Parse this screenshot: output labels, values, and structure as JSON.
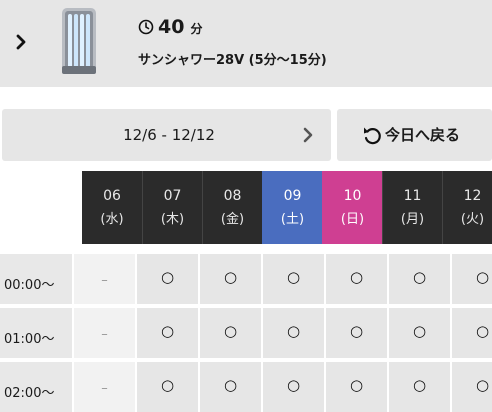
{
  "course": {
    "duration_value": "40",
    "duration_unit": "分",
    "name": "サンシャワー28V (5分〜15分)"
  },
  "week": {
    "range": "12/6 - 12/12",
    "today_label": "今日へ戻る"
  },
  "colors": {
    "saturday": "#4a6dbf",
    "sunday": "#cf3f92",
    "header_dark": "#2b2b2b"
  },
  "dates": [
    {
      "day": "06",
      "weekday": "(水)"
    },
    {
      "day": "07",
      "weekday": "(木)"
    },
    {
      "day": "08",
      "weekday": "(金)"
    },
    {
      "day": "09",
      "weekday": "(土)"
    },
    {
      "day": "10",
      "weekday": "(日)"
    },
    {
      "day": "11",
      "weekday": "(月)"
    },
    {
      "day": "12",
      "weekday": "(火)"
    }
  ],
  "rows": [
    {
      "time": "00:00〜",
      "slots": [
        "–",
        "○",
        "○",
        "○",
        "○",
        "○",
        "○"
      ]
    },
    {
      "time": "01:00〜",
      "slots": [
        "–",
        "○",
        "○",
        "○",
        "○",
        "○",
        "○"
      ]
    },
    {
      "time": "02:00〜",
      "slots": [
        "–",
        "○",
        "○",
        "○",
        "○",
        "○",
        "○"
      ]
    }
  ]
}
